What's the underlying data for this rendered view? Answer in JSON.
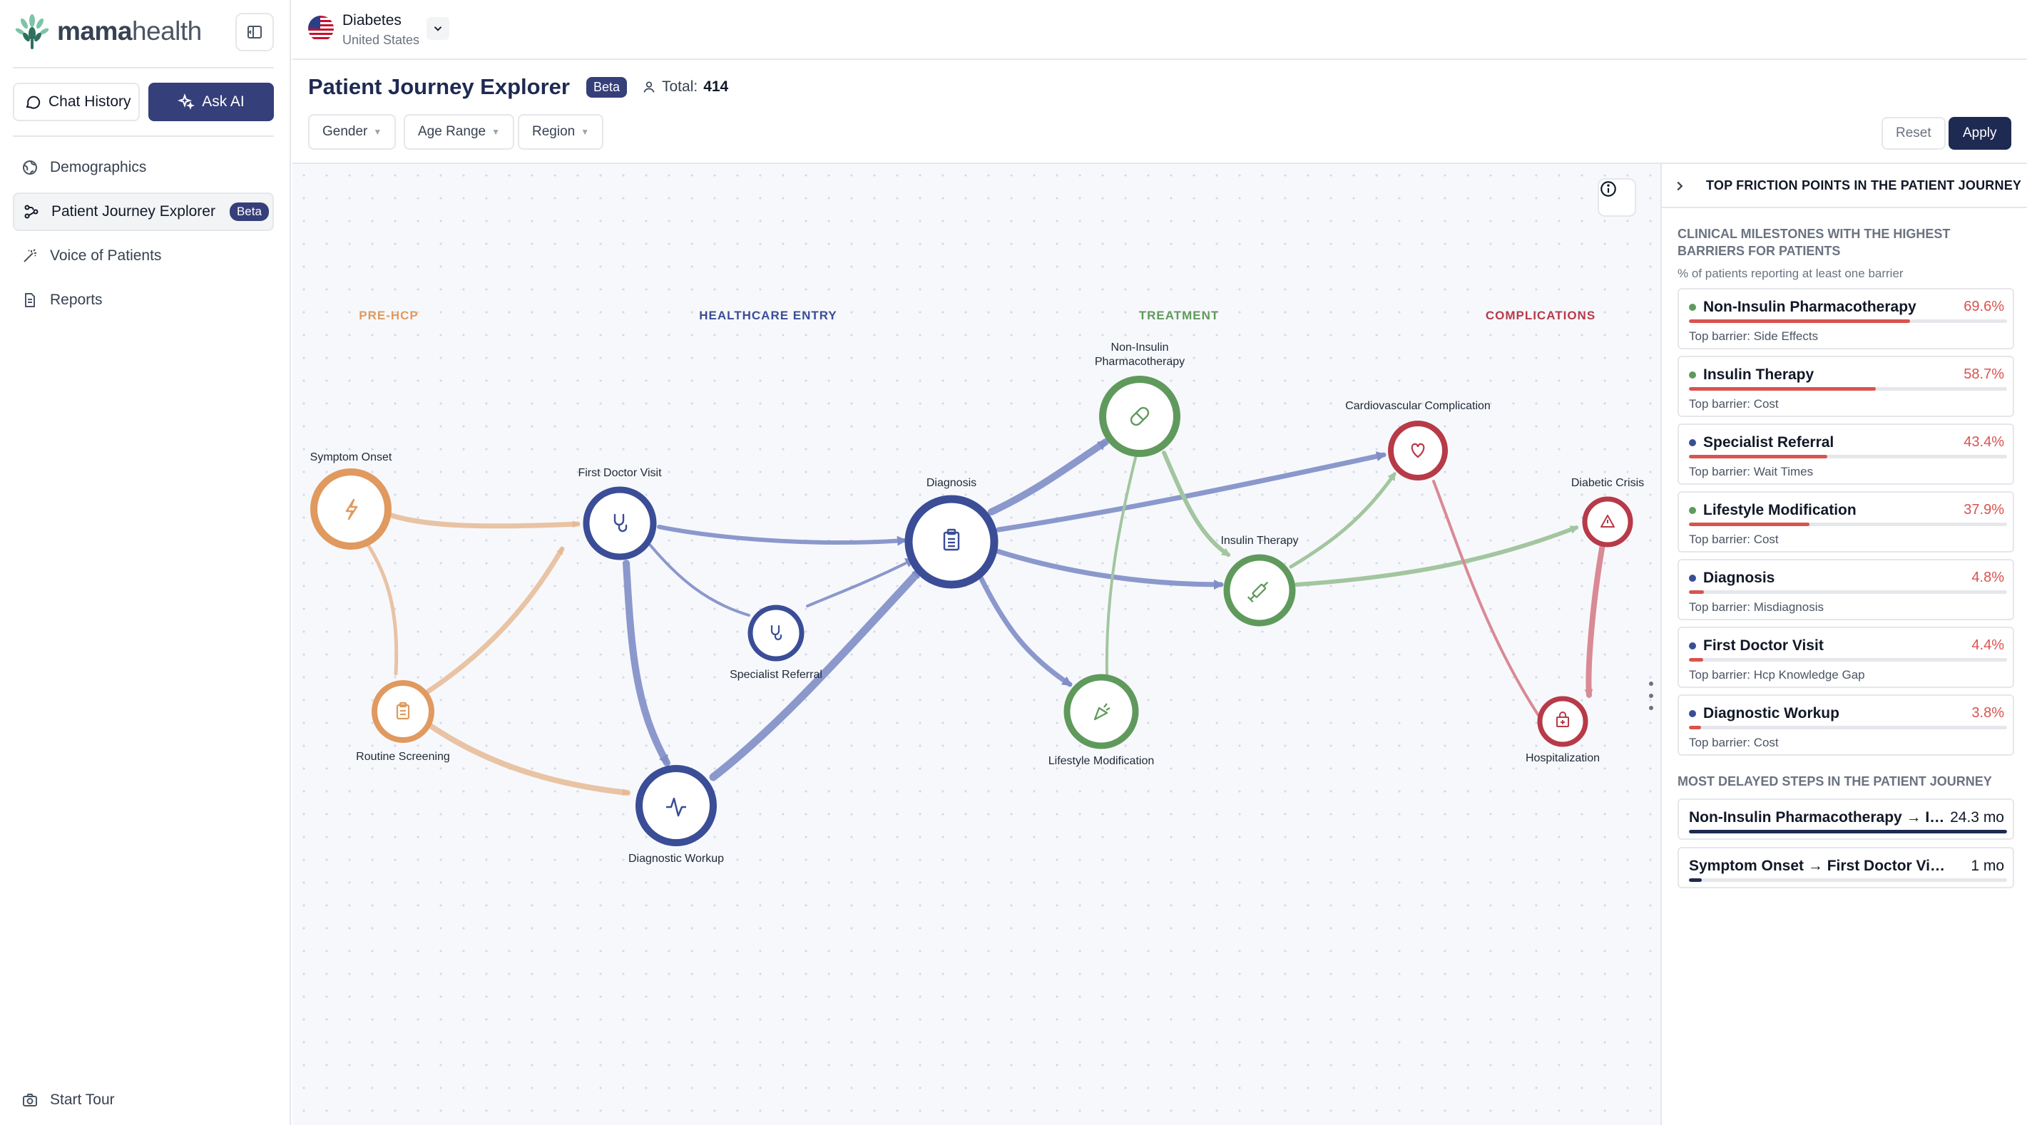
{
  "app": {
    "brand_bold": "mama",
    "brand_light": "health"
  },
  "sidebar": {
    "chat_history_label": "Chat History",
    "ask_ai_label": "Ask AI",
    "items": [
      {
        "label": "Demographics",
        "icon": "globe-icon"
      },
      {
        "label": "Patient Journey Explorer",
        "icon": "journey-icon",
        "badge": "Beta"
      },
      {
        "label": "Voice of Patients",
        "icon": "wand-icon"
      },
      {
        "label": "Reports",
        "icon": "document-icon"
      }
    ],
    "start_tour_label": "Start Tour"
  },
  "topbar": {
    "condition": "Diabetes",
    "country": "United States"
  },
  "header": {
    "title": "Patient Journey Explorer",
    "badge": "Beta",
    "total_label": "Total:",
    "total_value": "414",
    "filters": [
      "Gender",
      "Age Range",
      "Region"
    ],
    "reset_label": "Reset",
    "apply_label": "Apply"
  },
  "colors": {
    "pre_hcp": "#e0995e",
    "healthcare": "#3a4d96",
    "treatment": "#5f9a5c",
    "complications": "#b73a48",
    "barrier_bar": "#d9534f",
    "primary": "#353f79"
  },
  "graph": {
    "phases": [
      {
        "label": "PRE-HCP",
        "color": "#e0995e"
      },
      {
        "label": "HEALTHCARE ENTRY",
        "color": "#3a4d96"
      },
      {
        "label": "TREATMENT",
        "color": "#5f9a5c"
      },
      {
        "label": "COMPLICATIONS",
        "color": "#b73a48"
      }
    ],
    "nodes": [
      {
        "id": "symptom",
        "label": "Symptom Onset",
        "phase": "pre_hcp",
        "icon": "bolt-icon"
      },
      {
        "id": "screening",
        "label": "Routine Screening",
        "phase": "pre_hcp",
        "icon": "clipboard-icon"
      },
      {
        "id": "firstdoc",
        "label": "First Doctor Visit",
        "phase": "healthcare",
        "icon": "stethoscope-icon"
      },
      {
        "id": "specialist",
        "label": "Specialist Referral",
        "phase": "healthcare",
        "icon": "stethoscope-icon"
      },
      {
        "id": "workup",
        "label": "Diagnostic Workup",
        "phase": "healthcare",
        "icon": "pulse-icon"
      },
      {
        "id": "diagnosis",
        "label": "Diagnosis",
        "phase": "healthcare",
        "icon": "clipboard-list-icon"
      },
      {
        "id": "noninsulin",
        "label": "Non-Insulin Pharmacotherapy",
        "phase": "treatment",
        "icon": "pill-icon"
      },
      {
        "id": "insulin",
        "label": "Insulin Therapy",
        "phase": "treatment",
        "icon": "syringe-icon"
      },
      {
        "id": "lifestyle",
        "label": "Lifestyle Modification",
        "phase": "treatment",
        "icon": "carrot-icon"
      },
      {
        "id": "cardio",
        "label": "Cardiovascular Complication",
        "phase": "complications",
        "icon": "heart-icon"
      },
      {
        "id": "crisis",
        "label": "Diabetic Crisis",
        "phase": "complications",
        "icon": "warning-icon"
      },
      {
        "id": "hosp",
        "label": "Hospitalization",
        "phase": "complications",
        "icon": "hospital-icon"
      }
    ],
    "edges": [
      {
        "from": "symptom",
        "to": "firstdoc"
      },
      {
        "from": "symptom",
        "to": "screening"
      },
      {
        "from": "screening",
        "to": "firstdoc"
      },
      {
        "from": "screening",
        "to": "workup"
      },
      {
        "from": "firstdoc",
        "to": "diagnosis"
      },
      {
        "from": "firstdoc",
        "to": "specialist"
      },
      {
        "from": "firstdoc",
        "to": "workup"
      },
      {
        "from": "specialist",
        "to": "diagnosis"
      },
      {
        "from": "workup",
        "to": "diagnosis"
      },
      {
        "from": "diagnosis",
        "to": "noninsulin"
      },
      {
        "from": "diagnosis",
        "to": "cardio"
      },
      {
        "from": "diagnosis",
        "to": "insulin"
      },
      {
        "from": "diagnosis",
        "to": "lifestyle"
      },
      {
        "from": "noninsulin",
        "to": "insulin"
      },
      {
        "from": "noninsulin",
        "to": "lifestyle"
      },
      {
        "from": "insulin",
        "to": "cardio"
      },
      {
        "from": "insulin",
        "to": "crisis"
      },
      {
        "from": "cardio",
        "to": "hosp"
      },
      {
        "from": "crisis",
        "to": "hosp"
      }
    ]
  },
  "panel": {
    "title": "TOP FRICTION POINTS IN THE PATIENT JOURNEY",
    "subtitle": "CLINICAL MILESTONES WITH THE HIGHEST BARRIERS FOR PATIENTS",
    "note": "% of patients reporting at least one barrier",
    "friction_points": [
      {
        "name": "Non-Insulin Pharmacotherapy",
        "pct": "69.6%",
        "value": 69.6,
        "barrier": "Top barrier: Side Effects",
        "dot": "#5f9a5c"
      },
      {
        "name": "Insulin Therapy",
        "pct": "58.7%",
        "value": 58.7,
        "barrier": "Top barrier: Cost",
        "dot": "#5f9a5c"
      },
      {
        "name": "Specialist Referral",
        "pct": "43.4%",
        "value": 43.4,
        "barrier": "Top barrier: Wait Times",
        "dot": "#3a4d96"
      },
      {
        "name": "Lifestyle Modification",
        "pct": "37.9%",
        "value": 37.9,
        "barrier": "Top barrier: Cost",
        "dot": "#5f9a5c"
      },
      {
        "name": "Diagnosis",
        "pct": "4.8%",
        "value": 4.8,
        "barrier": "Top barrier: Misdiagnosis",
        "dot": "#3a4d96"
      },
      {
        "name": "First Doctor Visit",
        "pct": "4.4%",
        "value": 4.4,
        "barrier": "Top barrier: Hcp Knowledge Gap",
        "dot": "#3a4d96"
      },
      {
        "name": "Diagnostic Workup",
        "pct": "3.8%",
        "value": 3.8,
        "barrier": "Top barrier: Cost",
        "dot": "#3a4d96"
      }
    ],
    "delayed_title": "MOST DELAYED STEPS IN THE PATIENT JOURNEY",
    "delayed_steps": [
      {
        "name": "Non-Insulin Pharmacotherapy → In...",
        "value": "24.3 mo",
        "months": 24.3
      },
      {
        "name": "Symptom Onset → First Doctor Visit",
        "value": "1 mo",
        "months": 1
      }
    ]
  }
}
